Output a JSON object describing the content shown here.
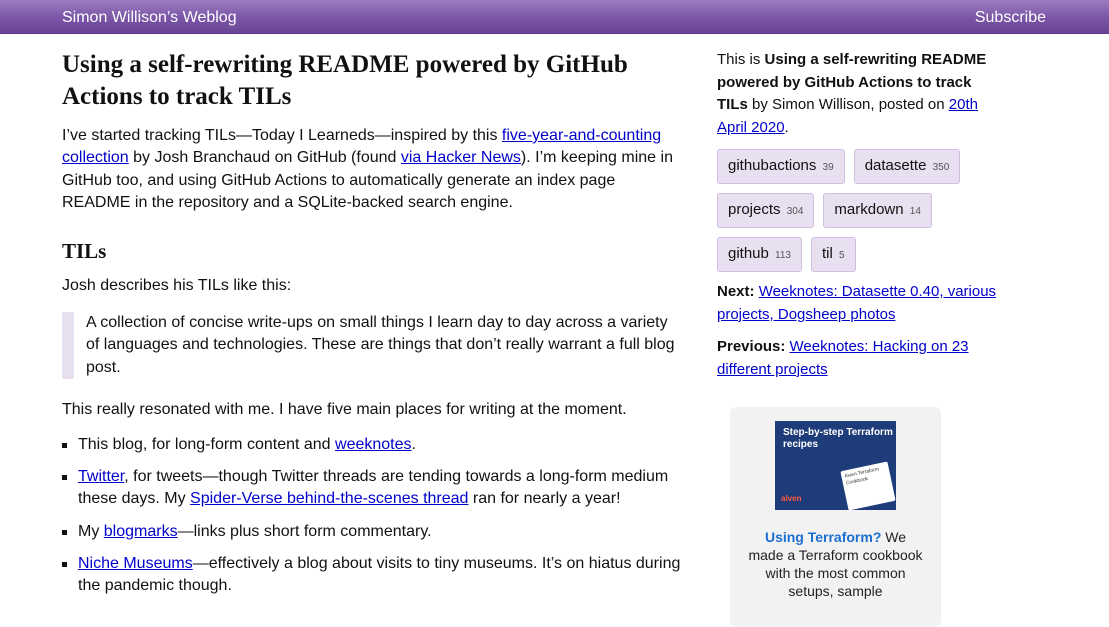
{
  "header": {
    "site_title": "Simon Willison’s Weblog",
    "subscribe": "Subscribe"
  },
  "post": {
    "title": "Using a self-rewriting README powered by GitHub Actions to track TILs",
    "intro": {
      "t1": "I’ve started tracking TILs—Today I Learneds—inspired by this ",
      "link1": "five-year-and-counting collection",
      "t2": " by Josh Branchaud on GitHub (found ",
      "link2": "via Hacker News",
      "t3": "). I’m keeping mine in GitHub too, and using GitHub Actions to automatically generate an index page README in the repository and a SQLite-backed search engine."
    },
    "heading_tils": "TILs",
    "josh_describes": "Josh describes his TILs like this:",
    "quote": "A collection of concise write-ups on small things I learn day to day across a variety of languages and technologies. These are things that don’t really warrant a full blog post.",
    "resonated": "This really resonated with me. I have five main places for writing at the moment.",
    "bullets": {
      "b1_t1": "This blog, for long-form content and ",
      "b1_link": "weeknotes",
      "b1_t2": ".",
      "b2_link": "Twitter",
      "b2_t1": ", for tweets—though Twitter threads are tending towards a long-form medium these days. My ",
      "b2_link2": "Spider-Verse behind-the-scenes thread",
      "b2_t2": " ran for nearly a year!",
      "b3_t1": "My ",
      "b3_link": "blogmarks",
      "b3_t2": "—links plus short form commentary.",
      "b4_link": "Niche Museums",
      "b4_t1": "—effectively a blog about visits to tiny museums. It’s on hiatus during the pandemic though."
    }
  },
  "sidebar": {
    "this_is": "This is ",
    "title_bold": "Using a self-rewriting README powered by GitHub Actions to track TILs",
    "by_line": " by Simon Willison, posted on ",
    "date_link": "20th April 2020",
    "period": ".",
    "tags": [
      {
        "name": "githubactions",
        "count": "39"
      },
      {
        "name": "datasette",
        "count": "350"
      },
      {
        "name": "projects",
        "count": "304"
      },
      {
        "name": "markdown",
        "count": "14"
      },
      {
        "name": "github",
        "count": "113"
      },
      {
        "name": "til",
        "count": "5"
      }
    ],
    "next_label": "Next:",
    "next_link": "Weeknotes: Datasette 0.40, various projects, Dogsheep photos",
    "prev_label": "Previous:",
    "prev_link": "Weeknotes: Hacking on 23 different projects",
    "promo": {
      "book_title": "Step-by-step Terraform recipes",
      "book_card": "Aiven Terraform Cookbook",
      "book_logo": "aiven",
      "link": "Using Terraform?",
      "text": " We made a Terraform cookbook with the most common setups, sample"
    }
  }
}
